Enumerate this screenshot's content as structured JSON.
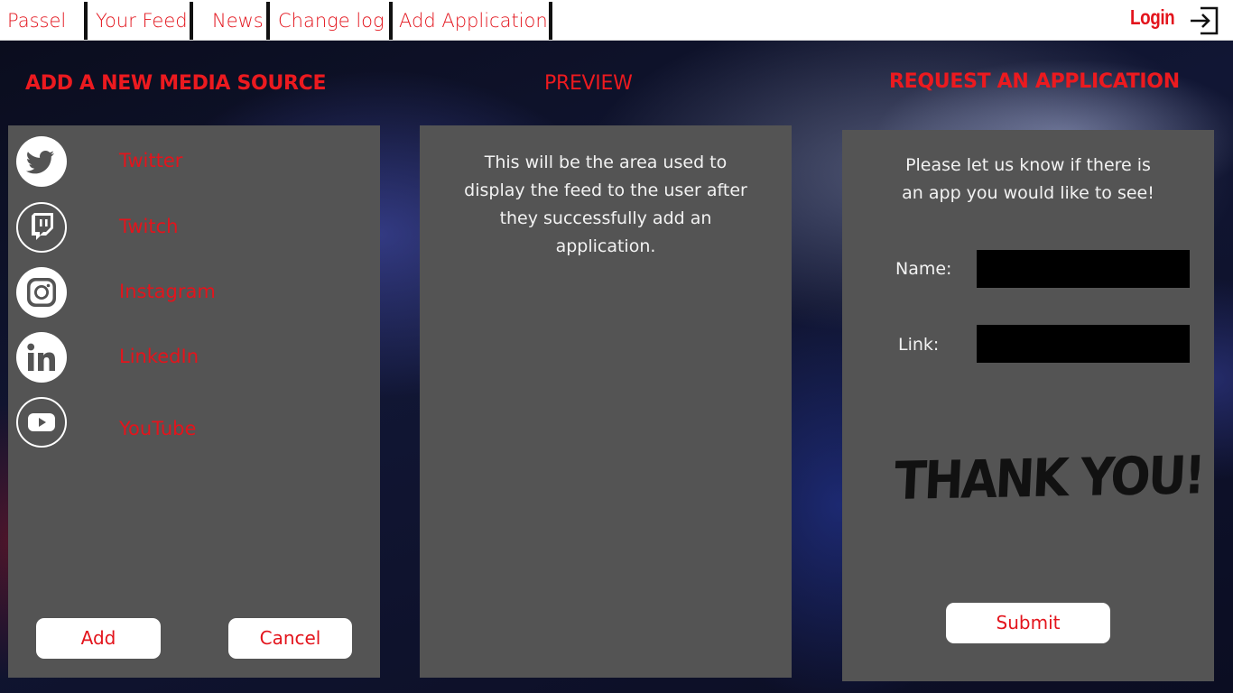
{
  "nav": {
    "items": [
      "Passel",
      "Your Feed",
      "News",
      "Change log",
      "Add Application"
    ],
    "login_label": "Login",
    "login_icon": "login-arrow-icon"
  },
  "headings": {
    "add_source": "ADD A NEW MEDIA SOURCE",
    "preview": "PREVIEW",
    "request": "REQUEST AN APPLICATION"
  },
  "media_sources": [
    {
      "label": "Twitter",
      "icon": "twitter-icon"
    },
    {
      "label": "Twitch",
      "icon": "twitch-icon"
    },
    {
      "label": "Instagram",
      "icon": "instagram-icon"
    },
    {
      "label": "LinkedIn",
      "icon": "linkedin-icon"
    },
    {
      "label": "YouTube",
      "icon": "youtube-icon"
    }
  ],
  "buttons": {
    "add": "Add",
    "cancel": "Cancel",
    "submit": "Submit"
  },
  "preview": {
    "text": "This will be the area used to display the feed to the user after they successfully add an application."
  },
  "request": {
    "intro": "Please let us know if there is an app you would like to see!",
    "name_label": "Name:",
    "name_value": "",
    "link_label": "Link:",
    "link_value": "",
    "thanks": "THANK YOU!"
  },
  "colors": {
    "accent": "#e3141c",
    "panel": "#545454",
    "input": "#000000",
    "nav_bg": "#ffffff"
  }
}
